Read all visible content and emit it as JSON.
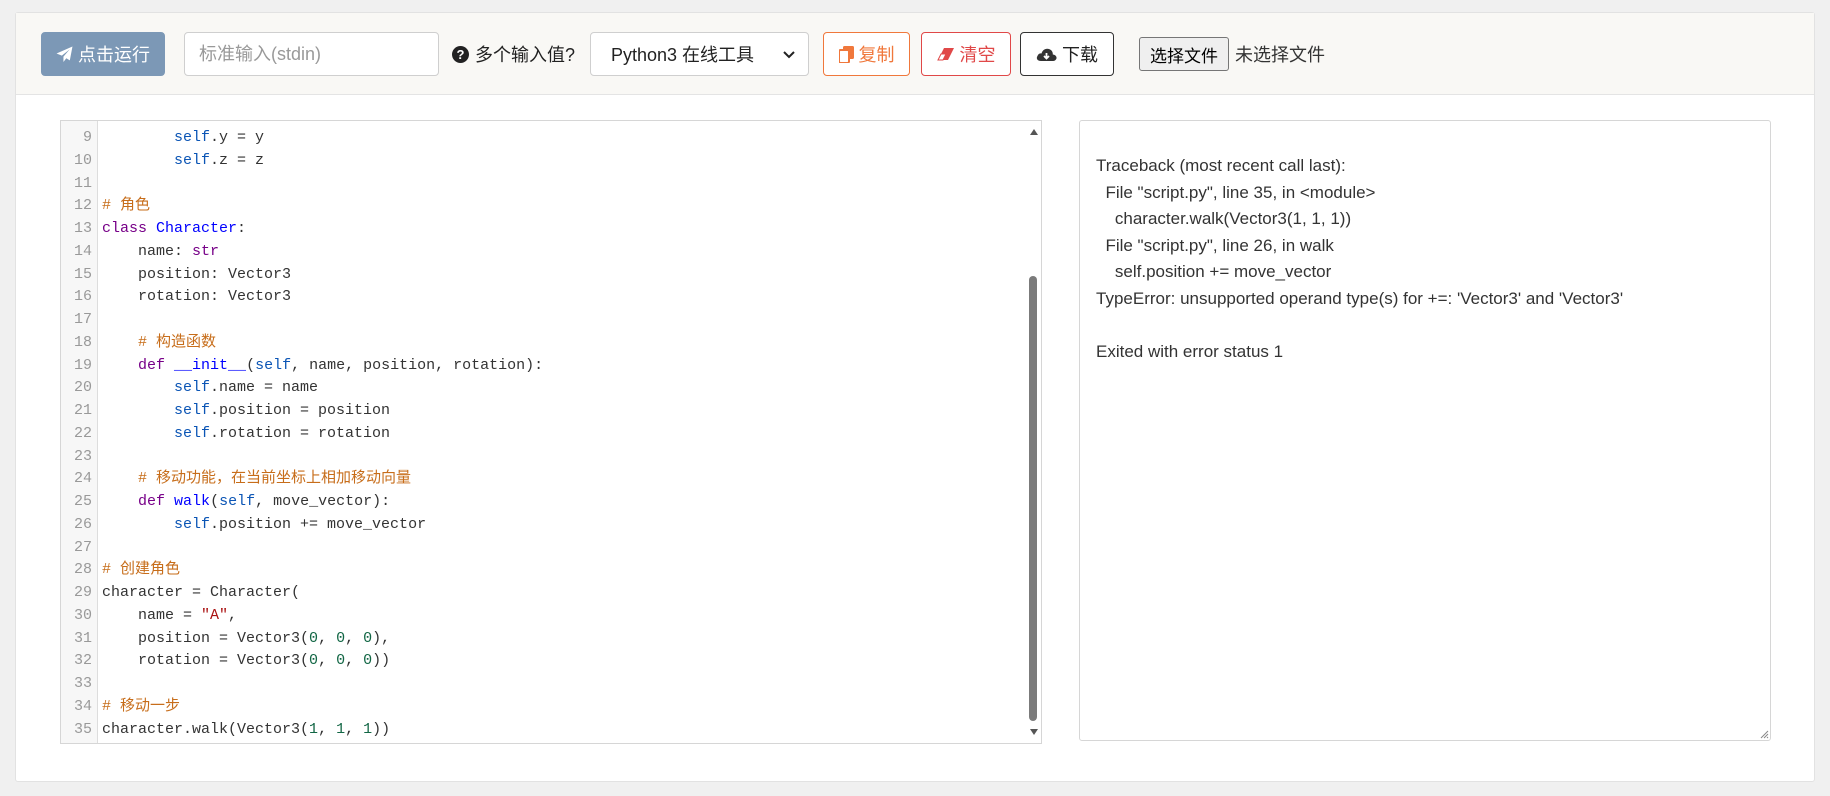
{
  "toolbar": {
    "run_label": "点击运行",
    "stdin_placeholder": "标准输入(stdin)",
    "multi_input_label": "多个输入值?",
    "language_selected": "Python3 在线工具",
    "copy_label": "复制",
    "clear_label": "清空",
    "download_label": "下载",
    "file_button_label": "选择文件",
    "file_status": "未选择文件"
  },
  "colors": {
    "run_button": "#7c98b6",
    "copy_button": "#f0783c",
    "clear_button": "#e04848"
  },
  "icons": {
    "run": "paper-plane-icon",
    "help": "question-circle-icon",
    "copy": "copy-icon",
    "clear": "eraser-icon",
    "download": "cloud-download-icon"
  },
  "editor": {
    "lines": [
      {
        "n": "9",
        "t": [
          [
            "",
            "        "
          ],
          [
            "self",
            "self"
          ],
          [
            "",
            ".y = y"
          ]
        ]
      },
      {
        "n": "10",
        "t": [
          [
            "",
            "        "
          ],
          [
            "self",
            "self"
          ],
          [
            "",
            ".z = z"
          ]
        ]
      },
      {
        "n": "11",
        "t": []
      },
      {
        "n": "12",
        "t": [
          [
            "cm",
            "# 角色"
          ]
        ]
      },
      {
        "n": "13",
        "t": [
          [
            "kw",
            "class"
          ],
          [
            "",
            " "
          ],
          [
            "def",
            "Character"
          ],
          [
            "",
            ":"
          ]
        ]
      },
      {
        "n": "14",
        "t": [
          [
            "",
            "    name: "
          ],
          [
            "type",
            "str"
          ]
        ]
      },
      {
        "n": "15",
        "t": [
          [
            "",
            "    position: Vector3"
          ]
        ]
      },
      {
        "n": "16",
        "t": [
          [
            "",
            "    rotation: Vector3"
          ]
        ]
      },
      {
        "n": "17",
        "t": []
      },
      {
        "n": "18",
        "t": [
          [
            "",
            "    "
          ],
          [
            "cm",
            "# 构造函数"
          ]
        ]
      },
      {
        "n": "19",
        "t": [
          [
            "",
            "    "
          ],
          [
            "kw",
            "def"
          ],
          [
            "",
            " "
          ],
          [
            "def",
            "__init__"
          ],
          [
            "",
            "("
          ],
          [
            "self",
            "self"
          ],
          [
            "",
            ", name, position, rotation):"
          ]
        ]
      },
      {
        "n": "20",
        "t": [
          [
            "",
            "        "
          ],
          [
            "self",
            "self"
          ],
          [
            "",
            ".name = name"
          ]
        ]
      },
      {
        "n": "21",
        "t": [
          [
            "",
            "        "
          ],
          [
            "self",
            "self"
          ],
          [
            "",
            ".position = position"
          ]
        ]
      },
      {
        "n": "22",
        "t": [
          [
            "",
            "        "
          ],
          [
            "self",
            "self"
          ],
          [
            "",
            ".rotation = rotation"
          ]
        ]
      },
      {
        "n": "23",
        "t": []
      },
      {
        "n": "24",
        "t": [
          [
            "",
            "    "
          ],
          [
            "cm",
            "# 移动功能，在当前坐标上相加移动向量"
          ]
        ]
      },
      {
        "n": "25",
        "t": [
          [
            "",
            "    "
          ],
          [
            "kw",
            "def"
          ],
          [
            "",
            " "
          ],
          [
            "def",
            "walk"
          ],
          [
            "",
            "("
          ],
          [
            "self",
            "self"
          ],
          [
            "",
            ", move_vector):"
          ]
        ]
      },
      {
        "n": "26",
        "t": [
          [
            "",
            "        "
          ],
          [
            "self",
            "self"
          ],
          [
            "",
            ".position += move_vector"
          ]
        ]
      },
      {
        "n": "27",
        "t": []
      },
      {
        "n": "28",
        "t": [
          [
            "cm",
            "# 创建角色"
          ]
        ]
      },
      {
        "n": "29",
        "t": [
          [
            "",
            "character = Character("
          ]
        ]
      },
      {
        "n": "30",
        "t": [
          [
            "",
            "    name = "
          ],
          [
            "str",
            "\"A\""
          ],
          [
            "",
            ","
          ]
        ]
      },
      {
        "n": "31",
        "t": [
          [
            "",
            "    position = Vector3("
          ],
          [
            "num",
            "0"
          ],
          [
            "",
            ", "
          ],
          [
            "num",
            "0"
          ],
          [
            "",
            ", "
          ],
          [
            "num",
            "0"
          ],
          [
            "",
            "),"
          ]
        ]
      },
      {
        "n": "32",
        "t": [
          [
            "",
            "    rotation = Vector3("
          ],
          [
            "num",
            "0"
          ],
          [
            "",
            ", "
          ],
          [
            "num",
            "0"
          ],
          [
            "",
            ", "
          ],
          [
            "num",
            "0"
          ],
          [
            "",
            "))"
          ]
        ]
      },
      {
        "n": "33",
        "t": []
      },
      {
        "n": "34",
        "t": [
          [
            "cm",
            "# 移动一步"
          ]
        ]
      },
      {
        "n": "35",
        "t": [
          [
            "",
            "character.walk(Vector3("
          ],
          [
            "num",
            "1"
          ],
          [
            "",
            ", "
          ],
          [
            "num",
            "1"
          ],
          [
            "",
            ", "
          ],
          [
            "num",
            "1"
          ],
          [
            "",
            "))"
          ]
        ]
      }
    ]
  },
  "output": {
    "text": "Traceback (most recent call last):\n  File \"script.py\", line 35, in <module>\n    character.walk(Vector3(1, 1, 1))\n  File \"script.py\", line 26, in walk\n    self.position += move_vector\nTypeError: unsupported operand type(s) for +=: 'Vector3' and 'Vector3'\n\nExited with error status 1"
  }
}
